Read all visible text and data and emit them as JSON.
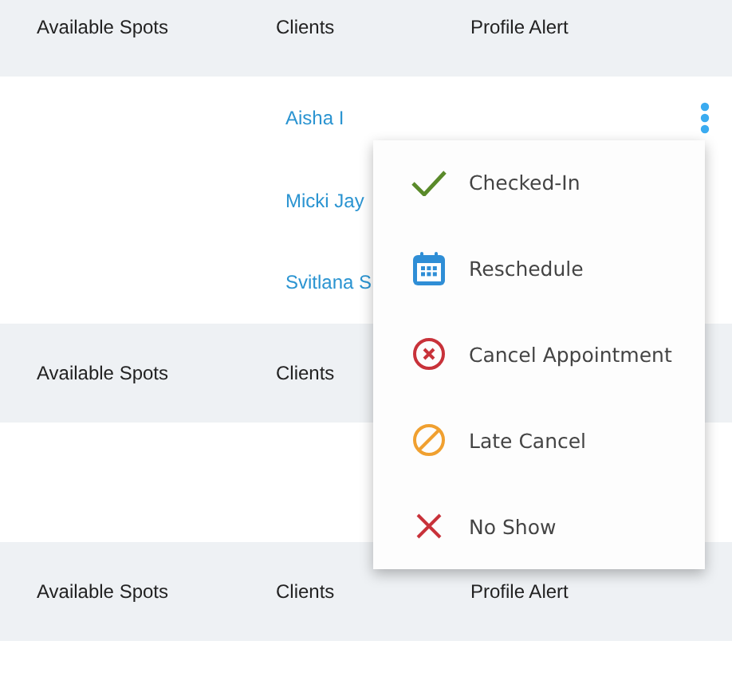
{
  "sections": [
    {
      "headers": [
        "Available Spots",
        "Clients",
        "Profile Alert"
      ],
      "clients": [
        "Aisha I",
        "Micki Jay",
        "Svitlana S"
      ],
      "kind": "clients"
    },
    {
      "headers": [
        "Available Spots",
        "Clients"
      ],
      "kind": "empty"
    },
    {
      "headers": [
        "Available Spots",
        "Clients",
        "Profile Alert"
      ],
      "kind": "empty"
    }
  ],
  "menu": {
    "items": [
      {
        "kind": "check",
        "label": "Checked-In"
      },
      {
        "kind": "calendar",
        "label": "Reschedule"
      },
      {
        "kind": "cancel",
        "label": "Cancel Appointment"
      },
      {
        "kind": "late",
        "label": "Late Cancel"
      },
      {
        "kind": "noshow",
        "label": "No Show"
      }
    ]
  }
}
